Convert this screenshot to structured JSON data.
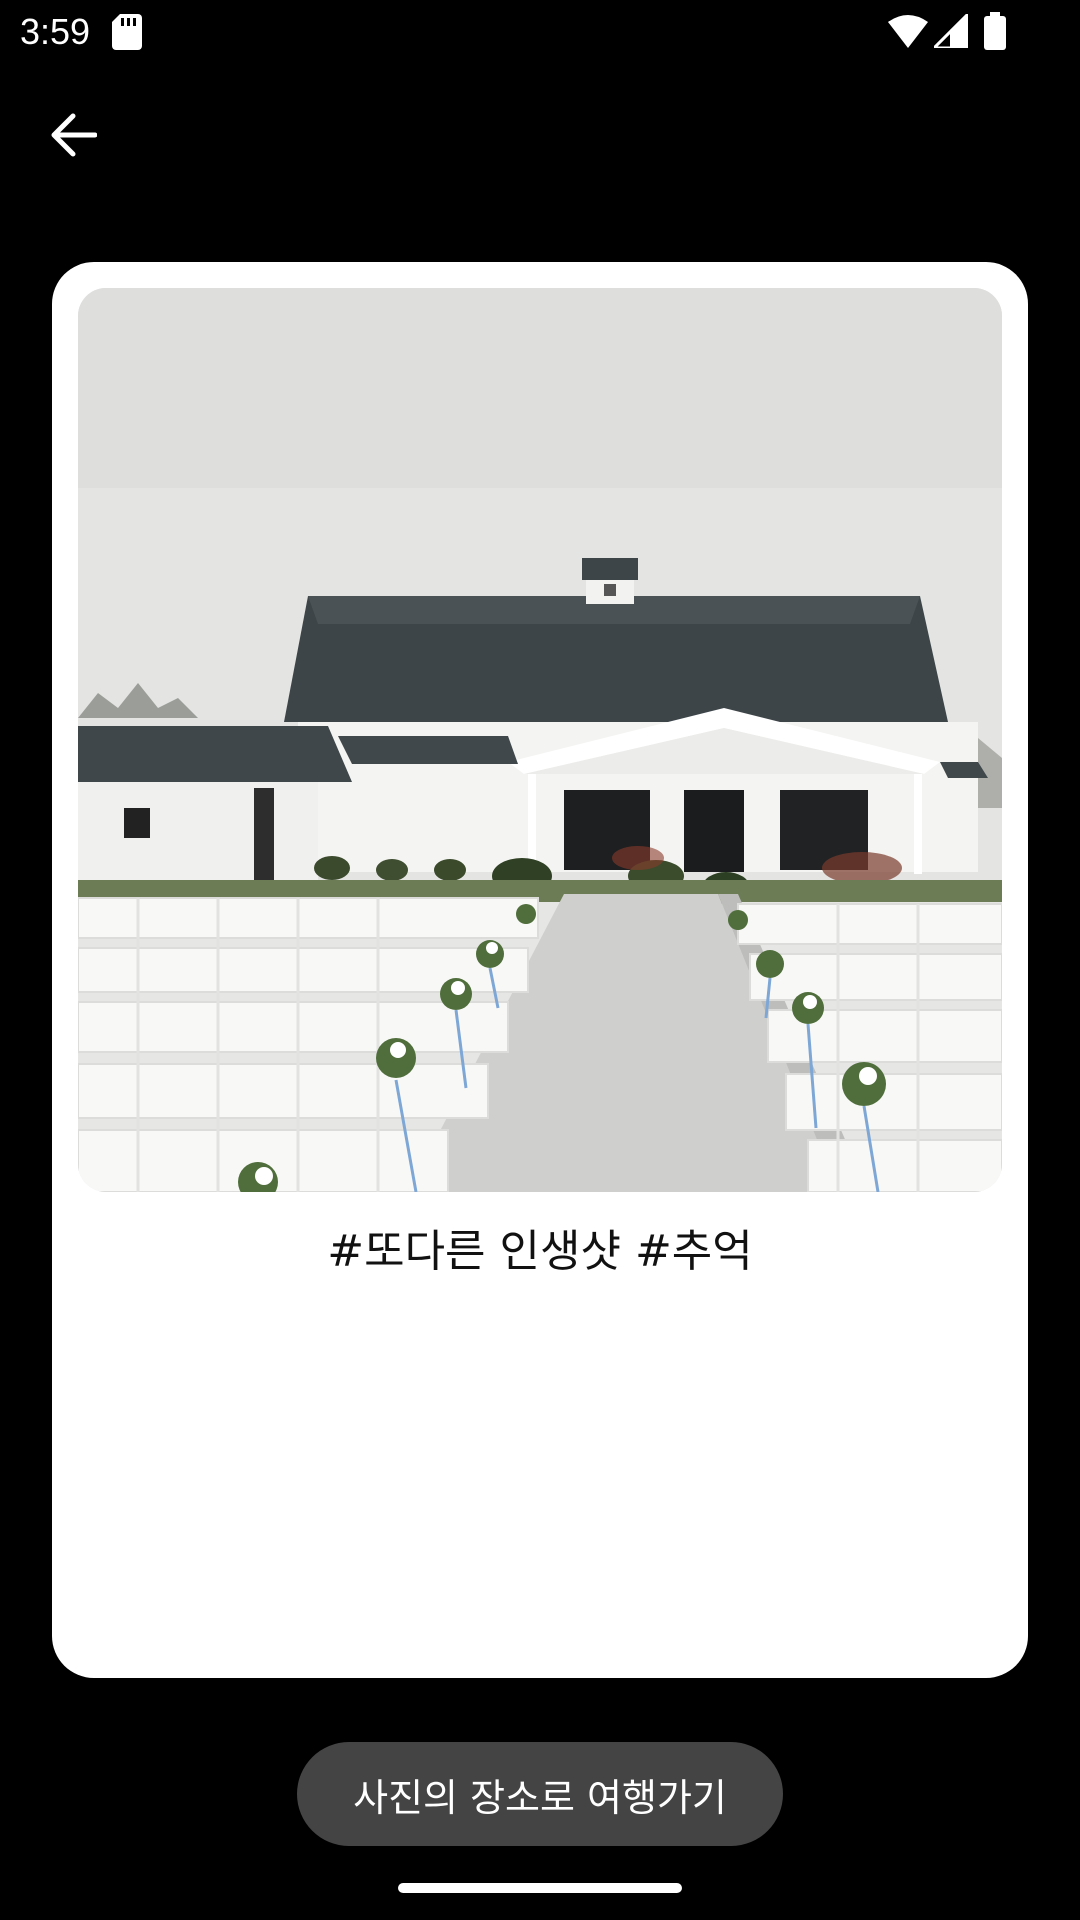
{
  "status_bar": {
    "time": "3:59",
    "icons": [
      "sd-card-icon",
      "wifi-icon",
      "signal-icon",
      "battery-icon"
    ]
  },
  "toolbar": {
    "back_icon": "arrow-left-icon"
  },
  "card": {
    "photo_subject": "wedding-venue-barn-photo",
    "caption": "#또다른 인생샷 #추억"
  },
  "action": {
    "label": "사진의 장소로 여행가기"
  },
  "colors": {
    "background": "#000000",
    "card": "#ffffff",
    "button": "#444444",
    "text_on_dark": "#ffffff"
  }
}
